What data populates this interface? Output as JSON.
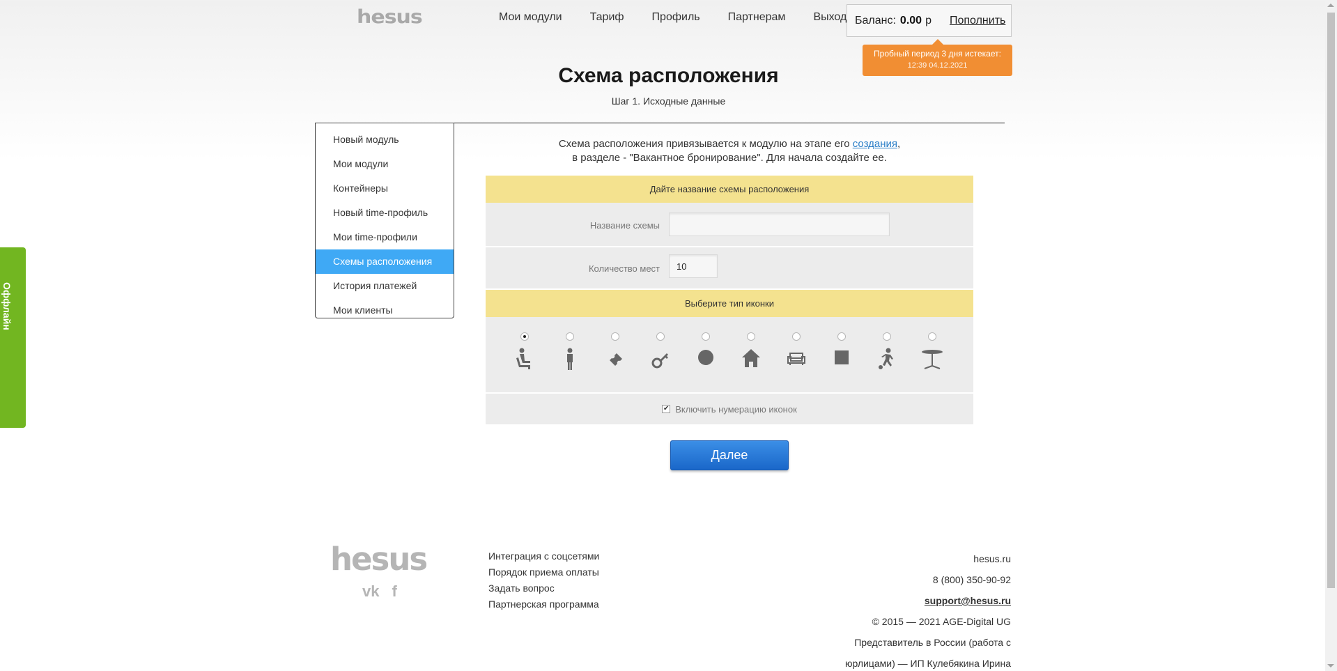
{
  "header": {
    "logo": "hesus",
    "nav": [
      "Мои модули",
      "Тариф",
      "Профиль",
      "Партнерам",
      "Выход"
    ],
    "balance_label": "Баланс:",
    "balance_value": "0.00",
    "balance_currency": "р",
    "topup_label": "Пополнить",
    "trial_line1": "Пробный период 3 дня истекает:",
    "trial_line2": "12:39 04.12.2021"
  },
  "page": {
    "title": "Схема расположения",
    "subtitle": "Шаг 1. Исходные данные"
  },
  "sidebar": {
    "items": [
      "Новый модуль",
      "Мои модули",
      "Контейнеры",
      "Новый time-профиль",
      "Мои time-профили",
      "Схемы расположения",
      "История платежей",
      "Мои клиенты"
    ],
    "active_index": 5
  },
  "content": {
    "intro_text1": "Схема расположения привязывается к модулю на этапе его ",
    "intro_link": "создания",
    "intro_text2": ",",
    "intro_line2": "в разделе - \"Вакантное бронирование\". Для начала создайте ее.",
    "name_section_title": "Дайте название схемы расположения",
    "name_label": "Название схемы",
    "name_value": "",
    "count_label": "Количество мест",
    "count_value": "10",
    "icon_section_title": "Выберите тип иконки",
    "icons": [
      "seat-person-icon",
      "standing-person-icon",
      "ticket-icon",
      "key-icon",
      "circle-icon",
      "house-icon",
      "sofa-icon",
      "square-icon",
      "football-player-icon",
      "table-icon"
    ],
    "selected_icon_index": 0,
    "numbering_label": "Включить нумерацию иконок",
    "numbering_checked": true,
    "next_button": "Далее"
  },
  "footer": {
    "logo": "hesus",
    "links": [
      "Интеграция с соцсетями",
      "Порядок приема оплаты",
      "Задать вопрос",
      "Партнерская программа"
    ],
    "site": "hesus.ru",
    "phone": "8 (800) 350-90-92",
    "email": "support@hesus.ru",
    "copyright": "© 2015 — 2021 AGE-Digital UG",
    "rep_line1": "Представитель в России (работа с",
    "rep_line2": "юрлицами) — ИП Кулебякина Ирина"
  },
  "offline_tab": "Оффлайн",
  "colors": {
    "accent": "#3fa9f5",
    "trial": "#f18e33",
    "section": "#f4e28f",
    "button": "#1a67c9",
    "offline": "#72b621"
  }
}
